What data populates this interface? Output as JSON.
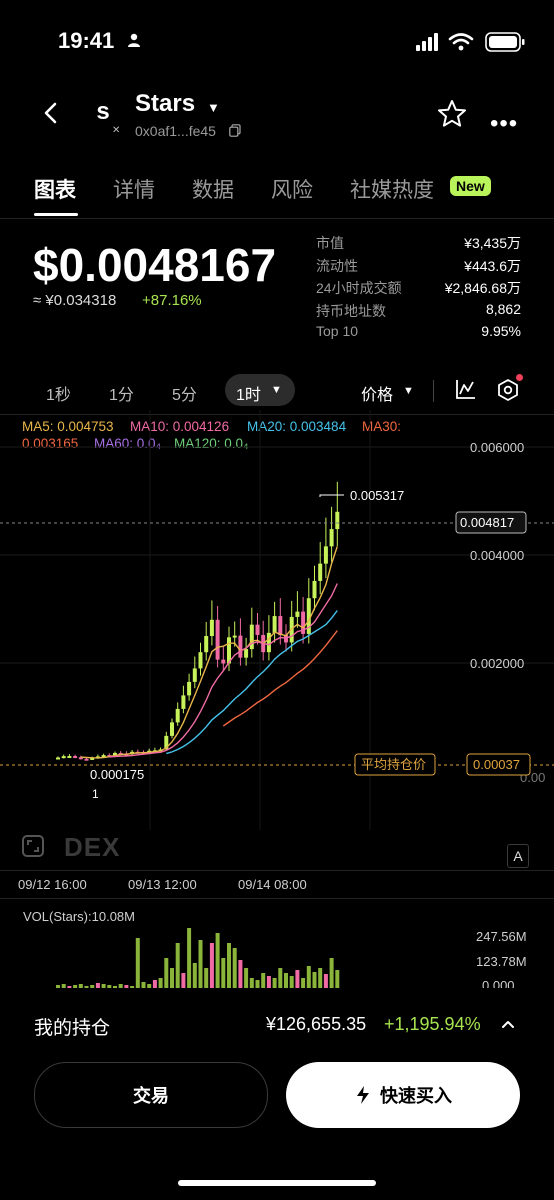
{
  "status": {
    "time": "19:41"
  },
  "header": {
    "logo_letter": "s",
    "token_name": "Stars",
    "address": "0x0af1...fe45",
    "chain_icon_glyph": "✕"
  },
  "tabs": [
    {
      "label": "图表"
    },
    {
      "label": "详情"
    },
    {
      "label": "数据"
    },
    {
      "label": "风险"
    },
    {
      "label": "社媒热度"
    }
  ],
  "new_badge": "New",
  "price": {
    "usd": "$0.0048167",
    "cny": "≈ ¥0.034318",
    "change": "+87.16%"
  },
  "stats": [
    {
      "label": "市值",
      "value": "¥3,435万"
    },
    {
      "label": "流动性",
      "value": "¥443.6万"
    },
    {
      "label": "24小时成交额",
      "value": "¥2,846.68万"
    },
    {
      "label": "持币地址数",
      "value": "8,862"
    },
    {
      "label": "Top 10",
      "value": "9.95%"
    }
  ],
  "intervals": {
    "i1": "1秒",
    "i2": "1分",
    "i3": "5分",
    "active": "1时"
  },
  "price_selector": "价格",
  "ma": {
    "ma5": "MA5: 0.004753",
    "ma10": "MA10: 0.004126",
    "ma20": "MA20: 0.003484",
    "ma30_a": "MA30:",
    "ma30_b": "0.003165",
    "ma60": "MA60: 0.0₄",
    "ma120": "MA120: 0.0₄"
  },
  "colors": {
    "ma5": "#e8b64a",
    "ma10": "#f06ba4",
    "ma20": "#46c2ea",
    "ma30": "#f0673f",
    "ma60": "#a871e6",
    "ma120": "#6fcf7a",
    "up": "#c7f25a",
    "down": "#f06ba4",
    "avg_line": "#e0a53f"
  },
  "chart_data": {
    "type": "candlestick",
    "y_ticks": [
      "0.006000",
      "0.004000",
      "0.002000",
      "0.00"
    ],
    "current_price": "0.004817",
    "high_label": "0.005317",
    "low_label": "0.000175",
    "low_marker": "1",
    "avg_label": "平均持仓价",
    "avg_value": "0.00037",
    "x_ticks": [
      "09/12 16:00",
      "09/13 12:00",
      "09/14 08:00"
    ]
  },
  "dex_logo": "DEX",
  "a_button": "A",
  "volume": {
    "title": "VOL(Stars):10.08M",
    "labels": [
      "247.56M",
      "123.78M",
      "0.000"
    ]
  },
  "position": {
    "label": "我的持仓",
    "value": "¥126,655.35",
    "change": "+1,195.94%"
  },
  "buttons": {
    "trade": "交易",
    "quick_buy": "快速买入"
  }
}
